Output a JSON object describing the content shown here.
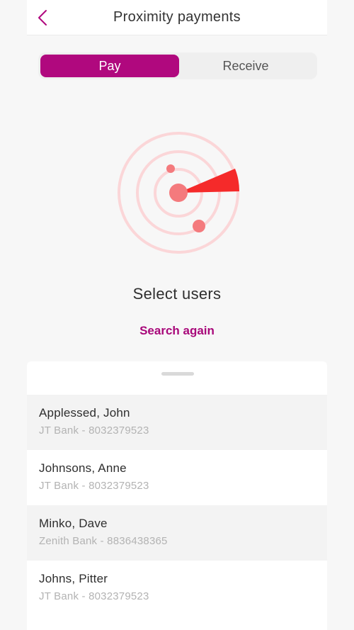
{
  "header": {
    "title": "Proximity payments",
    "back_icon": "chevron-left-icon"
  },
  "segment": {
    "pay_label": "Pay",
    "receive_label": "Receive",
    "selected": "Pay"
  },
  "radar": {
    "icon": "radar-icon"
  },
  "main": {
    "headline": "Select users",
    "search_again_label": "Search again"
  },
  "users": [
    {
      "name": "Applessed, John",
      "detail": "JT Bank - 8032379523"
    },
    {
      "name": "Johnsons, Anne",
      "detail": "JT Bank - 8032379523"
    },
    {
      "name": "Minko, Dave",
      "detail": "Zenith Bank - 8836438365"
    },
    {
      "name": "Johns, Pitter",
      "detail": "JT Bank - 8032379523"
    }
  ],
  "colors": {
    "accent": "#b0087e",
    "radar_ring": "#fbd6d8",
    "radar_dot": "#f47a7d",
    "radar_sweep": "#f52a2a"
  }
}
